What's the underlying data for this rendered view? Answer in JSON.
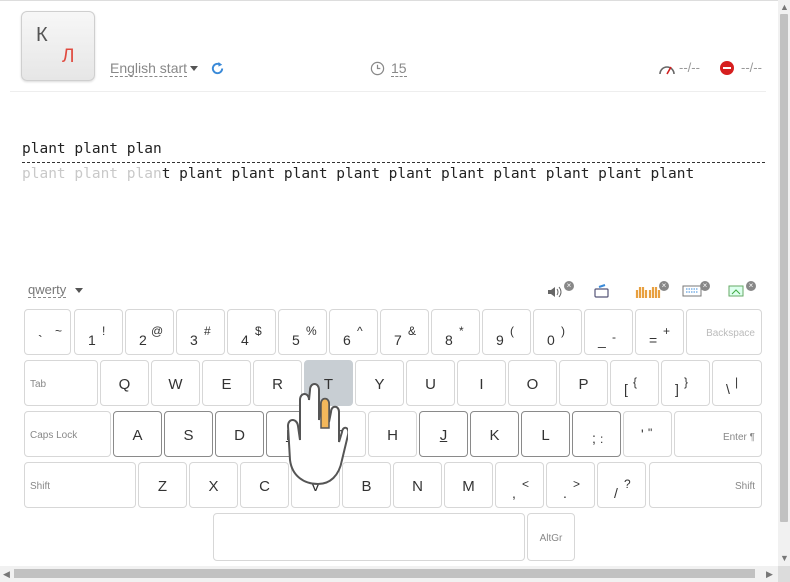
{
  "logo": {
    "left_letter": "К",
    "right_letter": "Л"
  },
  "header": {
    "lesson": "English start",
    "timer_value": "15",
    "speed_value": "--/--",
    "errors_value": "--/--"
  },
  "typing": {
    "typed_text": "plant plant plan",
    "source_done": "plant plant plan",
    "source_rest": "t plant plant plant plant plant plant plant plant plant plant"
  },
  "keyboard": {
    "layout": "qwerty",
    "rows": [
      [
        {
          "main": "`",
          "shift": "~"
        },
        {
          "main": "1",
          "shift": "!"
        },
        {
          "main": "2",
          "shift": "@"
        },
        {
          "main": "3",
          "shift": "#"
        },
        {
          "main": "4",
          "shift": "$"
        },
        {
          "main": "5",
          "shift": "%"
        },
        {
          "main": "6",
          "shift": "^"
        },
        {
          "main": "7",
          "shift": "&"
        },
        {
          "main": "8",
          "shift": "*"
        },
        {
          "main": "9",
          "shift": "("
        },
        {
          "main": "0",
          "shift": ")"
        },
        {
          "main": "_",
          "shift": "-"
        },
        {
          "main": "=",
          "shift": "+"
        },
        {
          "label": "Backspace"
        }
      ],
      [
        {
          "label": "Tab"
        },
        {
          "main": "Q"
        },
        {
          "main": "W"
        },
        {
          "main": "E"
        },
        {
          "main": "R"
        },
        {
          "main": "T"
        },
        {
          "main": "Y"
        },
        {
          "main": "U"
        },
        {
          "main": "I"
        },
        {
          "main": "O"
        },
        {
          "main": "P"
        },
        {
          "main": "[",
          "shift": "{"
        },
        {
          "main": "]",
          "shift": "}"
        },
        {
          "main": "\\",
          "shift": "|"
        }
      ],
      [
        {
          "label": "Caps Lock"
        },
        {
          "main": "A"
        },
        {
          "main": "S"
        },
        {
          "main": "D"
        },
        {
          "main": "F"
        },
        {
          "main": "G"
        },
        {
          "main": "H"
        },
        {
          "main": "J"
        },
        {
          "main": "K"
        },
        {
          "main": "L"
        },
        {
          "main": ";",
          "shift": ":"
        },
        {
          "main": "'",
          "shift": "\""
        },
        {
          "label": "Enter ¶"
        }
      ],
      [
        {
          "label": "Shift"
        },
        {
          "main": "Z"
        },
        {
          "main": "X"
        },
        {
          "main": "C"
        },
        {
          "main": "V"
        },
        {
          "main": "B"
        },
        {
          "main": "N"
        },
        {
          "main": "M"
        },
        {
          "main": ",",
          "shift": "<"
        },
        {
          "main": ".",
          "shift": ">"
        },
        {
          "main": "/",
          "shift": "?"
        },
        {
          "label": "Shift"
        }
      ],
      [
        {
          "label": "Space"
        },
        {
          "label": "AltGr"
        }
      ]
    ],
    "active_key": "T"
  }
}
